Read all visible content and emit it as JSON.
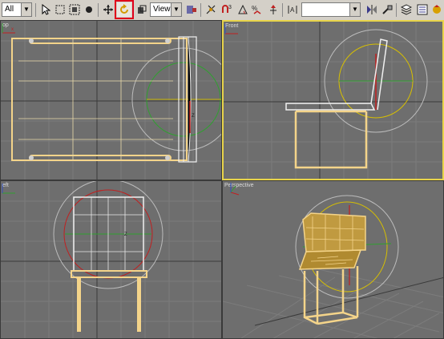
{
  "toolbar": {
    "filter_value": "All",
    "coord_value": "View",
    "selection_set_value": "",
    "icons": [
      "select-icon",
      "select-region-icon",
      "window-crossing-icon",
      "move-icon",
      "rotate-icon",
      "scale-icon",
      "snap-icon",
      "angle-snap-icon",
      "percent-snap-icon",
      "spinner-snap-icon",
      "mirror-icon",
      "align-icon",
      "layer-icon",
      "material-editor-icon"
    ]
  },
  "viewports": {
    "top": {
      "label": "op"
    },
    "front": {
      "label": "Front"
    },
    "left": {
      "label": "eft"
    },
    "perspective": {
      "label": "Perspective"
    }
  },
  "colors": {
    "viewport_bg": "#6e6e6e",
    "active_border": "#e8d44a",
    "highlight": "#e0001a",
    "chair": "#f4d48a"
  }
}
